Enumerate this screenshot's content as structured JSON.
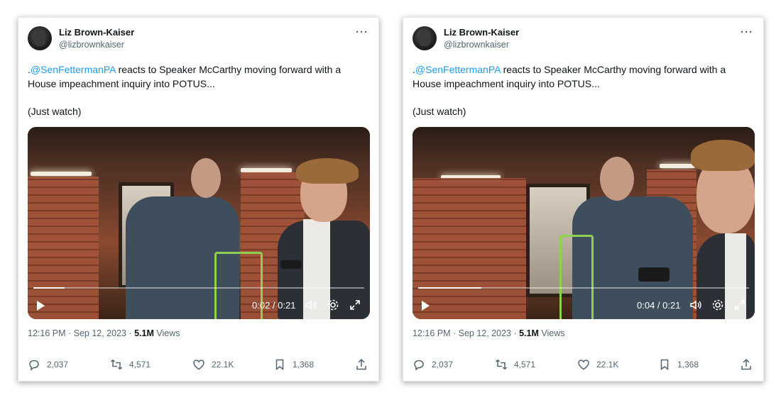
{
  "tweets": [
    {
      "author_name": "Liz Brown-Kaiser",
      "author_handle": "@lizbrownkaiser",
      "more_label": "···",
      "text_prefix": ".",
      "mention": "@SenFettermanPA",
      "text_rest": " reacts to Speaker McCarthy moving forward with a House impeachment inquiry into POTUS...",
      "text_line2": "(Just watch)",
      "video_time": "0:02 / 0:21",
      "video_progress": 0.095,
      "timestamp": "12:16 PM · Sep 12, 2023 · ",
      "views_count": "5.1M",
      "views_label": " Views",
      "replies": "2,037",
      "retweets": "4,571",
      "likes": "22.1K",
      "bookmarks": "1,368"
    },
    {
      "author_name": "Liz Brown-Kaiser",
      "author_handle": "@lizbrownkaiser",
      "more_label": "···",
      "text_prefix": ".",
      "mention": "@SenFettermanPA",
      "text_rest": " reacts to Speaker McCarthy moving forward with a House impeachment inquiry into POTUS...",
      "text_line2": "(Just watch)",
      "video_time": "0:04 / 0:21",
      "video_progress": 0.19,
      "timestamp": "12:16 PM · Sep 12, 2023 · ",
      "views_count": "5.1M",
      "views_label": " Views",
      "replies": "2,037",
      "retweets": "4,571",
      "likes": "22.1K",
      "bookmarks": "1,368"
    }
  ],
  "colors": {
    "mention": "#1d9bf0",
    "secondary_text": "#536471",
    "highlight_box": "#8fd14f"
  },
  "icons": [
    "more-icon",
    "play-icon",
    "volume-icon",
    "settings-icon",
    "fullscreen-icon",
    "reply-icon",
    "retweet-icon",
    "like-icon",
    "bookmark-icon",
    "share-icon"
  ]
}
